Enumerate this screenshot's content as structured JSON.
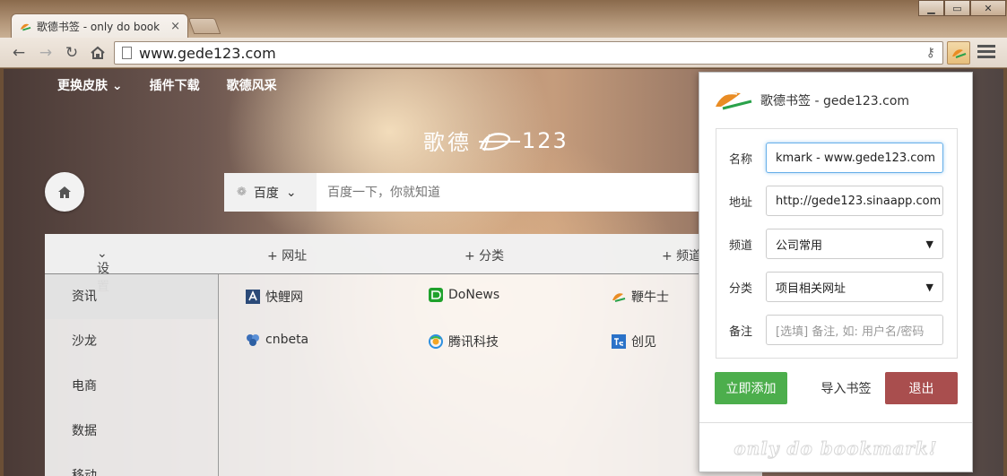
{
  "browser": {
    "tab_title": "歌德书签 - only do book",
    "url": "www.gede123.com",
    "close_glyph": "×",
    "minimize_glyph": "▁",
    "maximize_glyph": "▭",
    "window_close_glyph": "✕"
  },
  "page": {
    "top_nav": [
      "更换皮肤",
      "插件下载",
      "歌德风采"
    ],
    "brand_cn": "歌德",
    "brand_num": "123",
    "search": {
      "engine": "百度",
      "placeholder": "百度一下，你就知道"
    },
    "panel_tabs": [
      "设置",
      "+ 网址",
      "+ 分类",
      "+ 频道"
    ],
    "sidebar": [
      "资讯",
      "沙龙",
      "电商",
      "数据",
      "移动"
    ],
    "sites": [
      {
        "name": "快鲤网",
        "icon": "kuaili-icon",
        "color": "#2b4a78"
      },
      {
        "name": "DoNews",
        "icon": "donews-icon",
        "color": "#1fa12c"
      },
      {
        "name": "鞭牛士",
        "icon": "bianniushi-icon",
        "color": "#e98c24"
      },
      {
        "name": "cnbeta",
        "icon": "cnbeta-icon",
        "color": "#3b6fb8"
      },
      {
        "name": "腾讯科技",
        "icon": "tencent-icon",
        "color": "#2d8fe0"
      },
      {
        "name": "创见",
        "icon": "chuangjian-icon",
        "color": "#2a72c8"
      }
    ]
  },
  "popup": {
    "title": "歌德书签 - gede123.com",
    "fields": {
      "name_label": "名称",
      "name_value": "kmark - www.gede123.com",
      "url_label": "地址",
      "url_value": "http://gede123.sinaapp.com",
      "channel_label": "频道",
      "channel_value": "公司常用",
      "category_label": "分类",
      "category_value": "项目相关网址",
      "note_label": "备注",
      "note_placeholder": "[选填] 备注, 如: 用户名/密码"
    },
    "buttons": {
      "add": "立即添加",
      "import": "导入书签",
      "exit": "退出"
    },
    "footer": "only do bookmark!"
  }
}
